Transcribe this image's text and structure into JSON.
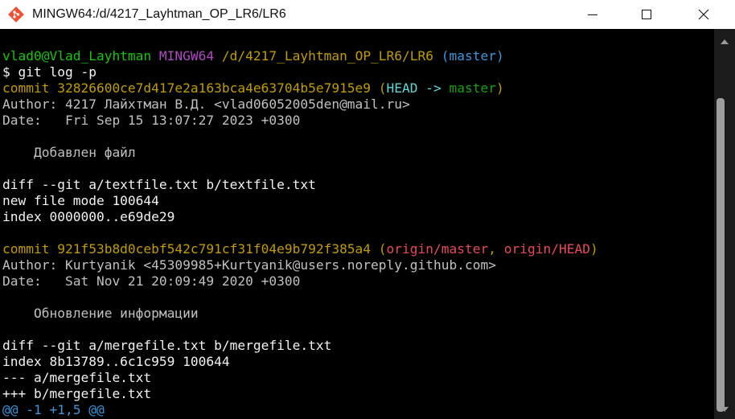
{
  "window": {
    "title": "MINGW64:/d/4217_Layhtman_OP_LR6/LR6",
    "icon": "git-bash-icon",
    "controls": [
      "minimize-icon",
      "maximize-icon",
      "close-icon"
    ]
  },
  "colors": {
    "default": "#c0c0c0",
    "user": "#16c60c",
    "mingw": "#b148c6",
    "path": "#c19c00",
    "branch_paren": "#3a96dd",
    "commit": "#c19c00",
    "head": "#61d6d6",
    "master": "#13a10e",
    "origin": "#e74856",
    "hunk": "#3a96dd",
    "white": "#f2f2f2"
  },
  "lines": [
    [
      {
        "t": "vlad0@Vlad_Layhtman ",
        "c": "user"
      },
      {
        "t": "MINGW64 ",
        "c": "mingw"
      },
      {
        "t": "/d/4217_Layhtman_OP_LR6/LR6",
        "c": "path"
      },
      {
        "t": " (master)",
        "c": "branch_paren"
      }
    ],
    [
      {
        "t": "$ git log -p",
        "c": "white"
      }
    ],
    [
      {
        "t": "commit 32826600ce7d417e2a163bca4e63704b5e7915e9 (",
        "c": "commit"
      },
      {
        "t": "HEAD -> ",
        "c": "head"
      },
      {
        "t": "master",
        "c": "master"
      },
      {
        "t": ")",
        "c": "commit"
      }
    ],
    [
      {
        "t": "Author: 4217 Лайхтман В.Д. <vlad06052005den@mail.ru>",
        "c": "default"
      }
    ],
    [
      {
        "t": "Date:   Fri Sep 15 13:07:27 2023 +0300",
        "c": "default"
      }
    ],
    [],
    [
      {
        "t": "    Добавлен файл",
        "c": "default"
      }
    ],
    [],
    [
      {
        "t": "diff --git a/textfile.txt b/textfile.txt",
        "c": "white"
      }
    ],
    [
      {
        "t": "new file mode 100644",
        "c": "white"
      }
    ],
    [
      {
        "t": "index 0000000..e69de29",
        "c": "white"
      }
    ],
    [],
    [
      {
        "t": "commit 921f53b8d0cebf542c791cf31f04e9b792f385a4 (",
        "c": "commit"
      },
      {
        "t": "origin/master",
        "c": "origin"
      },
      {
        "t": ", ",
        "c": "commit"
      },
      {
        "t": "origin/HEAD",
        "c": "origin"
      },
      {
        "t": ")",
        "c": "commit"
      }
    ],
    [
      {
        "t": "Author: Kurtyanik <45309985+Kurtyanik@users.noreply.github.com>",
        "c": "default"
      }
    ],
    [
      {
        "t": "Date:   Sat Nov 21 20:09:49 2020 +0300",
        "c": "default"
      }
    ],
    [],
    [
      {
        "t": "    Обновление информации",
        "c": "default"
      }
    ],
    [],
    [
      {
        "t": "diff --git a/mergefile.txt b/mergefile.txt",
        "c": "white"
      }
    ],
    [
      {
        "t": "index 8b13789..6c1c959 100644",
        "c": "white"
      }
    ],
    [
      {
        "t": "--- a/mergefile.txt",
        "c": "white"
      }
    ],
    [
      {
        "t": "+++ b/mergefile.txt",
        "c": "white"
      }
    ],
    [
      {
        "t": "@@ -1 +1,5 @@",
        "c": "hunk"
      }
    ]
  ]
}
